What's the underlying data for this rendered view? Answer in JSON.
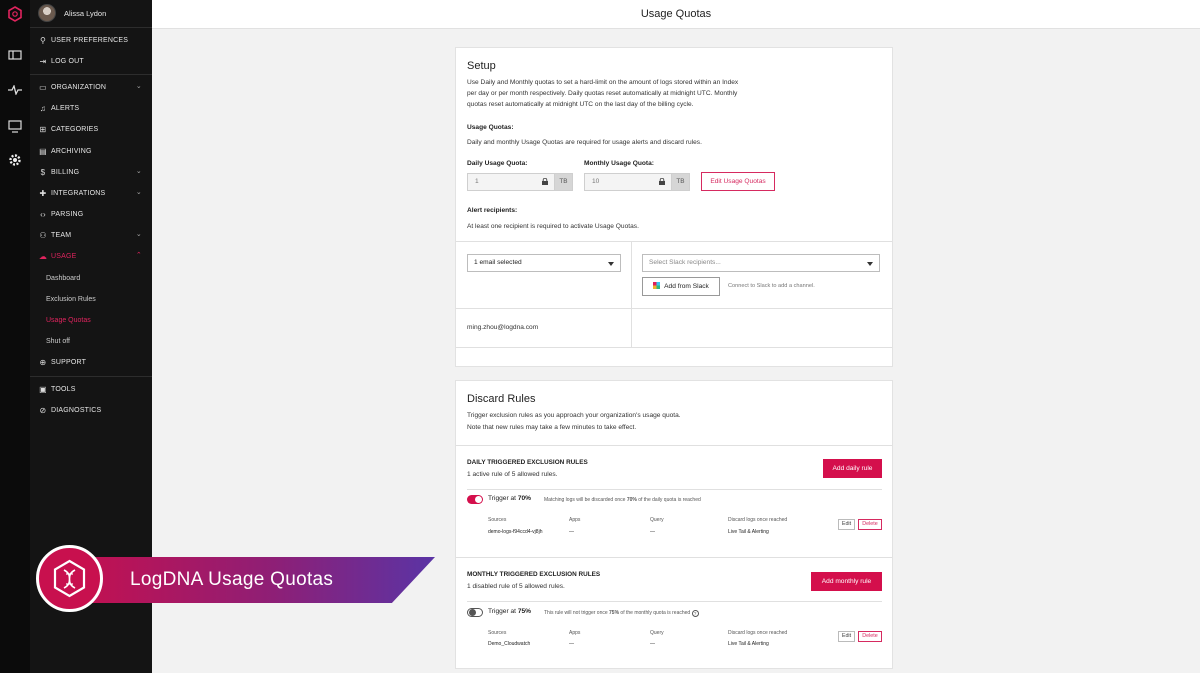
{
  "colors": {
    "accent": "#d40f4c",
    "sidebar_bg": "#141414",
    "rail_bg": "#0b0b0b"
  },
  "rail": {
    "icons": [
      "logo-icon",
      "views-icon",
      "pulse-icon",
      "monitor-icon",
      "settings-icon"
    ]
  },
  "user": {
    "name": "Alissa Lydon"
  },
  "nav": {
    "user_preferences": "USER PREFERENCES",
    "log_out": "LOG OUT",
    "organization": "ORGANIZATION",
    "alerts": "ALERTS",
    "categories": "CATEGORIES",
    "archiving": "ARCHIVING",
    "billing": "BILLING",
    "integrations": "INTEGRATIONS",
    "parsing": "PARSING",
    "team": "TEAM",
    "usage": "USAGE",
    "usage_sub": {
      "dashboard": "Dashboard",
      "exclusion_rules": "Exclusion Rules",
      "usage_quotas": "Usage Quotas",
      "shut_off": "Shut off"
    },
    "support": "SUPPORT",
    "tools": "TOOLS",
    "diagnostics": "DIAGNOSTICS"
  },
  "header": {
    "title": "Usage Quotas"
  },
  "setup": {
    "title": "Setup",
    "desc": [
      "Use Daily and Monthly quotas to set a hard-limit on the amount of logs stored within an Index",
      "per day or per month respectively. Daily quotas reset automatically at midnight UTC. Monthly",
      "quotas reset automatically at midnight UTC on the last day of the billing cycle."
    ],
    "usage_quotas_label": "Usage Quotas:",
    "usage_quotas_desc": "Daily and monthly Usage Quotas are required for usage alerts and discard rules.",
    "daily_label": "Daily Usage Quota:",
    "daily_value": "1",
    "daily_unit": "TB",
    "monthly_label": "Monthly Usage Quota:",
    "monthly_value": "10",
    "monthly_unit": "TB",
    "edit_button": "Edit Usage Quotas",
    "alert_label": "Alert recipients:",
    "alert_desc": "At least one recipient is required to activate Usage Quotas.",
    "email_select": "1 email selected",
    "slack_placeholder": "Select Slack recipients...",
    "add_slack": "Add from Slack",
    "slack_hint": "Connect to Slack to add a channel.",
    "email_recipient": "ming.zhou@logdna.com"
  },
  "discard": {
    "title": "Discard Rules",
    "desc": [
      "Trigger exclusion rules as you approach your organization's usage quota.",
      "Note that new rules may take a few minutes to take effect."
    ],
    "daily": {
      "heading": "DAILY TRIGGERED EXCLUSION RULES",
      "count": "1 active rule of 5 allowed rules.",
      "add_button": "Add daily rule",
      "trigger_prefix": "Trigger at ",
      "trigger_pct": "70%",
      "enabled": true,
      "note_a": "Matching logs will be discarded once ",
      "note_b": "70%",
      "note_c": " of the daily quota is reached",
      "cols": [
        "Sources",
        "Apps",
        "Query",
        "Discard logs once reached"
      ],
      "row": [
        "demo-logs-f94ccd4-vj8jh",
        "—",
        "—",
        "Live Tail & Alerting"
      ],
      "edit": "Edit",
      "delete": "Delete"
    },
    "monthly": {
      "heading": "MONTHLY TRIGGERED EXCLUSION RULES",
      "count": "1 disabled rule of 5 allowed rules.",
      "add_button": "Add monthly rule",
      "trigger_prefix": "Trigger at ",
      "trigger_pct": "75%",
      "enabled": false,
      "note_a": "This rule will not trigger once ",
      "note_b": "75%",
      "note_c": " of the monthly quota is reached",
      "cols": [
        "Sources",
        "Apps",
        "Query",
        "Discard logs once reached"
      ],
      "row": [
        "Demo_Cloudwatch",
        "—",
        "—",
        "Live Tail & Alerting"
      ],
      "edit": "Edit",
      "delete": "Delete"
    }
  },
  "banner": {
    "title": "LogDNA Usage Quotas"
  }
}
